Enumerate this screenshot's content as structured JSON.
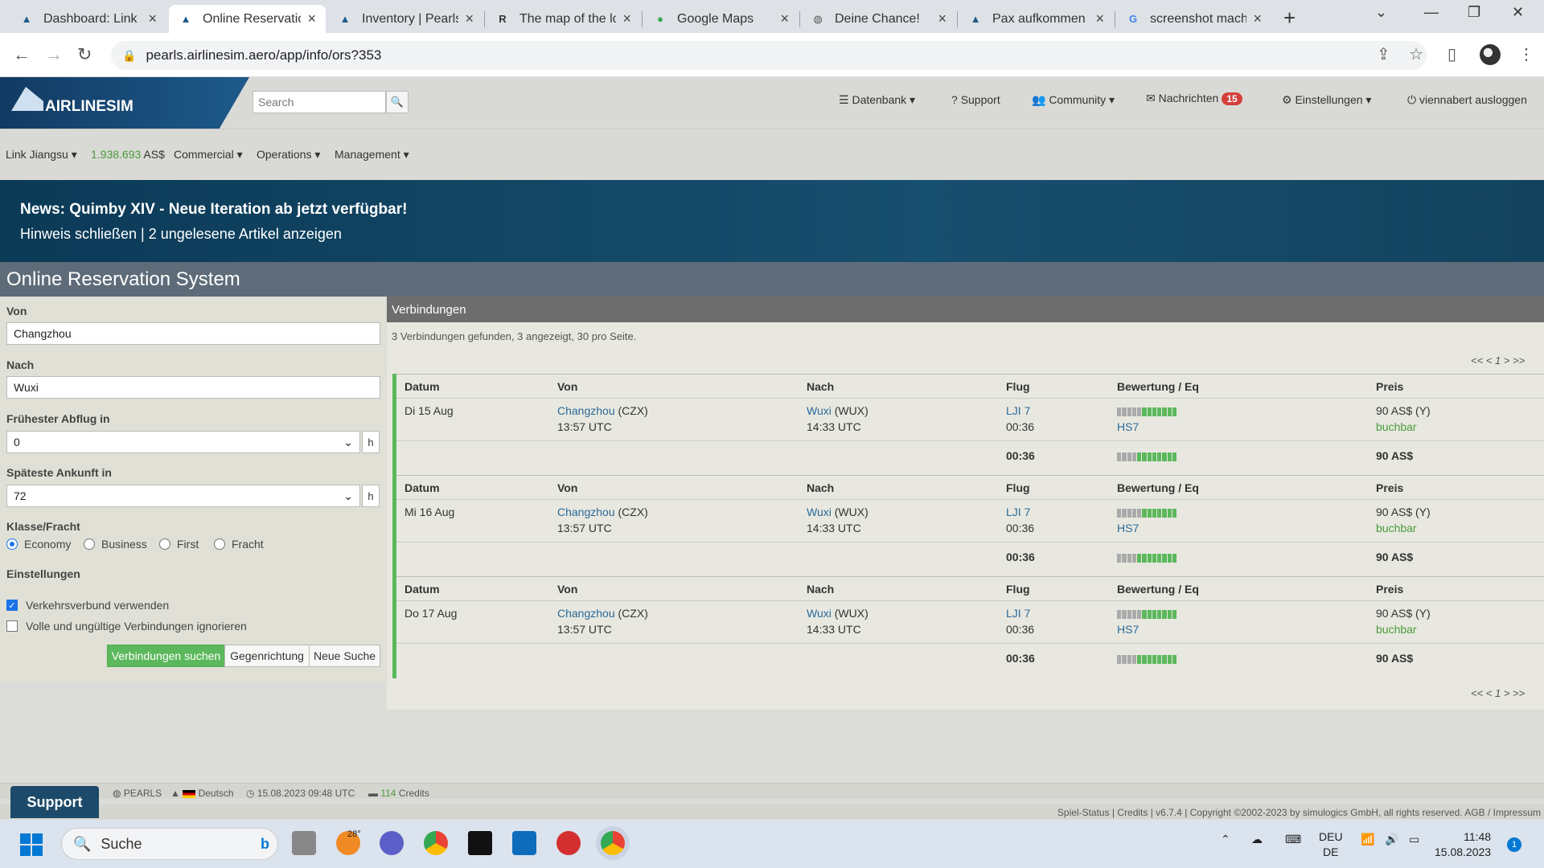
{
  "browser": {
    "tabs": [
      {
        "title": "Dashboard: Link X",
        "icon": "airlinesim-icon"
      },
      {
        "title": "Online Reservatio",
        "icon": "airlinesim-icon",
        "active": true
      },
      {
        "title": "Inventory | Pearls",
        "icon": "airlinesim-icon"
      },
      {
        "title": "The map of the lo",
        "icon": "r6-icon"
      },
      {
        "title": "Google Maps",
        "icon": "maps-icon"
      },
      {
        "title": "Deine Chance!",
        "icon": "globe-icon"
      },
      {
        "title": "Pax aufkommen g",
        "icon": "airlinesim-icon"
      },
      {
        "title": "screenshot mache",
        "icon": "google-icon"
      }
    ],
    "url": "pearls.airlinesim.aero/app/info/ors?353"
  },
  "header": {
    "logo_text": "AIRLINESIM",
    "search_placeholder": "Search",
    "nav": {
      "datenbank": "Datenbank",
      "support": "Support",
      "community": "Community",
      "nachrichten": "Nachrichten",
      "nachrichten_count": "15",
      "einstellungen": "Einstellungen",
      "logout": "viennabert ausloggen"
    }
  },
  "subnav": {
    "airline": "Link Jiangsu",
    "balance": "1.938.693",
    "currency": "AS$",
    "commercial": "Commercial",
    "operations": "Operations",
    "management": "Management"
  },
  "news": {
    "title": "News: Quimby XIV - Neue Iteration ab jetzt verfügbar!",
    "links": "Hinweis schließen | 2 ungelesene Artikel anzeigen"
  },
  "page_title": "Online Reservation System",
  "form": {
    "von_label": "Von",
    "von_value": "Changzhou",
    "nach_label": "Nach",
    "nach_value": "Wuxi",
    "abflug_label": "Frühester Abflug in",
    "abflug_value": "0",
    "ankunft_label": "Späteste Ankunft in",
    "ankunft_value": "72",
    "unit": "h",
    "klasse_label": "Klasse/Fracht",
    "klassen": [
      "Economy",
      "Business",
      "First",
      "Fracht"
    ],
    "klasse_selected": "Economy",
    "einstellungen_label": "Einstellungen",
    "opt_verkehrsverbund": "Verkehrsverbund verwenden",
    "opt_verkehrsverbund_checked": true,
    "opt_ignorieren": "Volle und ungültige Verbindungen ignorieren",
    "opt_ignorieren_checked": false,
    "btn_suchen": "Verbindungen suchen",
    "btn_gegenrichtung": "Gegenrichtung",
    "btn_neue_suche": "Neue Suche"
  },
  "results": {
    "header": "Verbindungen",
    "summary": "3 Verbindungen gefunden, 3 angezeigt, 30 pro Seite.",
    "pager": "<< < 1 > >>",
    "columns": [
      "Datum",
      "Von",
      "Nach",
      "Flug",
      "Bewertung / Eq",
      "Preis"
    ],
    "rows": [
      {
        "datum": "Di 15 Aug",
        "von_city": "Changzhou",
        "von_code": "(CZX)",
        "von_time": "13:57 UTC",
        "nach_city": "Wuxi",
        "nach_code": "(WUX)",
        "nach_time": "14:33 UTC",
        "flug": "LJI 7",
        "dauer": "00:36",
        "rating": 0.6,
        "eq": "HS7",
        "preis": "90 AS$ (Y)",
        "status": "buchbar",
        "total_dauer": "00:36",
        "total_preis": "90 AS$"
      },
      {
        "datum": "Mi 16 Aug",
        "von_city": "Changzhou",
        "von_code": "(CZX)",
        "von_time": "13:57 UTC",
        "nach_city": "Wuxi",
        "nach_code": "(WUX)",
        "nach_time": "14:33 UTC",
        "flug": "LJI 7",
        "dauer": "00:36",
        "rating": 0.6,
        "eq": "HS7",
        "preis": "90 AS$ (Y)",
        "status": "buchbar",
        "total_dauer": "00:36",
        "total_preis": "90 AS$"
      },
      {
        "datum": "Do 17 Aug",
        "von_city": "Changzhou",
        "von_code": "(CZX)",
        "von_time": "13:57 UTC",
        "nach_city": "Wuxi",
        "nach_code": "(WUX)",
        "nach_time": "14:33 UTC",
        "flug": "LJI 7",
        "dauer": "00:36",
        "rating": 0.6,
        "eq": "HS7",
        "preis": "90 AS$ (Y)",
        "status": "buchbar",
        "total_dauer": "00:36",
        "total_preis": "90 AS$"
      }
    ]
  },
  "status": {
    "server": "PEARLS",
    "language": "Deutsch",
    "datetime": "15.08.2023 09:48 UTC",
    "credits_count": "114",
    "credits_label": "Credits",
    "support": "Support",
    "footer": "Spiel-Status | Credits | v6.7.4 | Copyright ©2002-2023 by simulogics GmbH, all rights reserved. AGB / Impressum"
  },
  "taskbar": {
    "search": "Suche",
    "weather": "28°",
    "lang_top": "DEU",
    "lang_bottom": "DE",
    "time": "11:48",
    "date": "15.08.2023",
    "notifications": "1"
  },
  "colors": {
    "accent_green": "#5cb85c",
    "brand_blue": "#123a63",
    "badge_red": "#d43f3a"
  }
}
